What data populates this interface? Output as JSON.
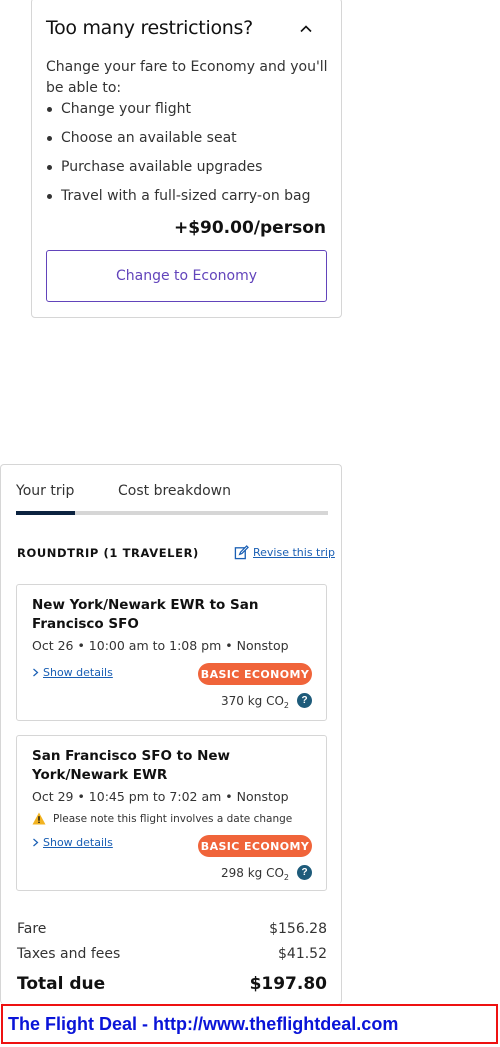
{
  "restrictions": {
    "title": "Too many restrictions?",
    "collapse_icon": "chevron-up-icon",
    "intro": "Change your fare to Economy and you'll be able to:",
    "benefits": [
      "Change your flight",
      "Choose an available seat",
      "Purchase available upgrades",
      "Travel with a full-sized carry-on bag"
    ],
    "price": "+$90.00/person",
    "button_label": "Change to Economy"
  },
  "trip": {
    "tabs": [
      "Your trip",
      "Cost breakdown"
    ],
    "active_tab": "Your trip",
    "heading": "ROUNDTRIP (1 TRAVELER)",
    "revise_label": "Revise this trip",
    "flights": [
      {
        "route": "New York/Newark EWR to San Francisco SFO",
        "schedule": "Oct 26 • 10:00 am to 1:08 pm • Nonstop",
        "show_details": "Show details",
        "fare_badge": "BASIC ECONOMY",
        "co2_value": "370 kg CO",
        "co2_sub": "2"
      },
      {
        "route": "San Francisco SFO to New York/Newark EWR",
        "schedule": "Oct 29 • 10:45 pm to 7:02 am • Nonstop",
        "warning": "Please note this flight involves a date change",
        "show_details": "Show details",
        "fare_badge": "BASIC ECONOMY",
        "co2_value": "298 kg CO",
        "co2_sub": "2"
      }
    ],
    "costs": {
      "fare_label": "Fare",
      "fare_value": "$156.28",
      "taxes_label": "Taxes and fees",
      "taxes_value": "$41.52",
      "total_label": "Total due",
      "total_value": "$197.80"
    }
  },
  "banner": {
    "text": "The Flight Deal - http://www.theflightdeal.com"
  },
  "colors": {
    "accent_purple": "#6244bb",
    "badge_orange": "#f0643a",
    "link_blue": "#1a5fb4",
    "tab_active": "#0c2340",
    "banner_border": "#ee1111",
    "banner_text": "#0a14d8"
  },
  "help_icon_glyph": "?"
}
